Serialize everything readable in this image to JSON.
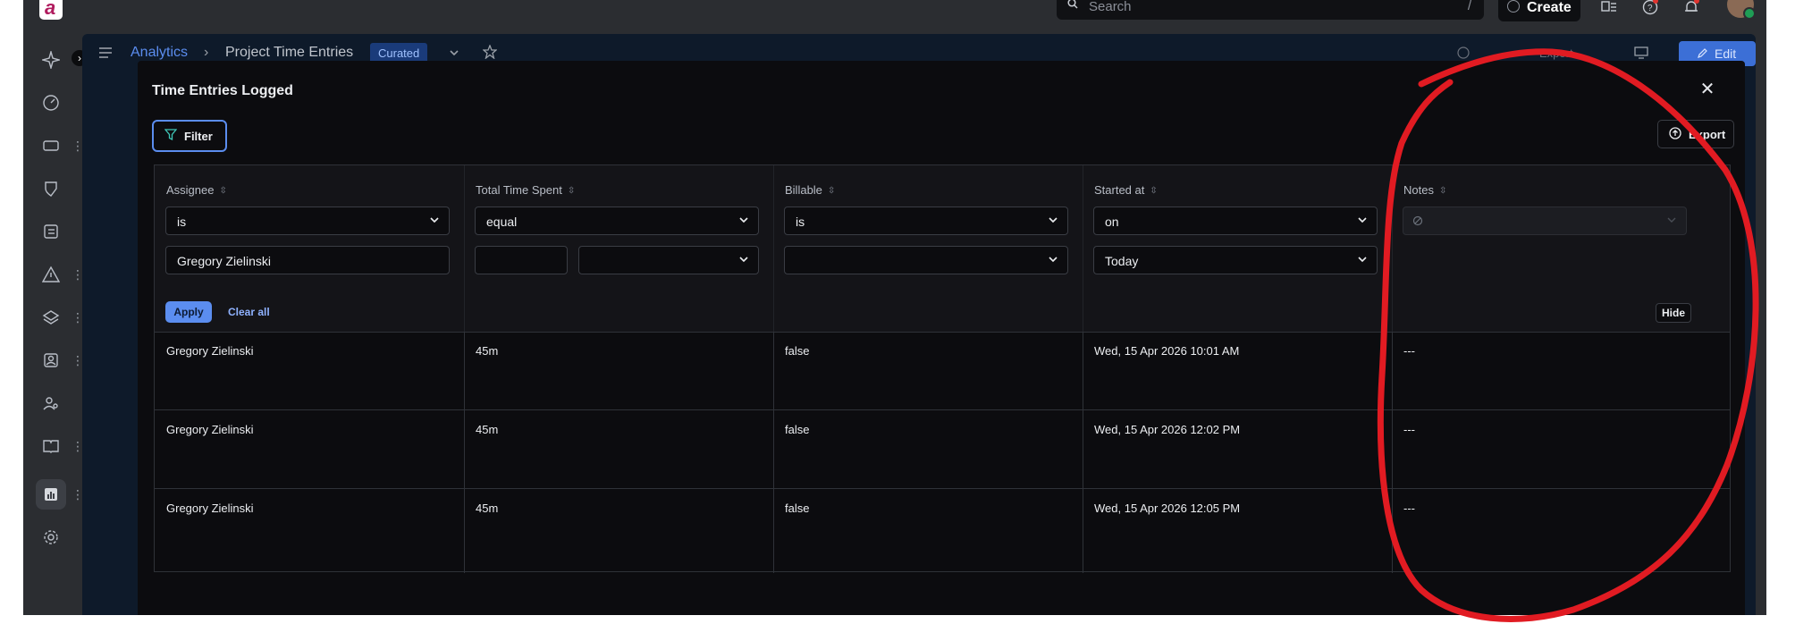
{
  "topbar": {
    "search_placeholder": "Search",
    "search_shortcut": "/",
    "create_label": "Create"
  },
  "rail": {
    "items": [
      "sparkle-icon",
      "gauge-icon",
      "ticket-icon",
      "shield-icon",
      "checklist-icon",
      "warning-icon",
      "layers-icon",
      "contact-icon",
      "people-icon",
      "book-icon",
      "report-icon",
      "settings-icon"
    ]
  },
  "page": {
    "breadcrumb_root": "Analytics",
    "breadcrumb_separator": "›",
    "breadcrumb_current": "Project Time Entries",
    "badge": "Curated",
    "export_label": "Export",
    "edit_label": "Edit"
  },
  "modal": {
    "title": "Time Entries Logged",
    "filter_label": "Filter",
    "export_label": "Export",
    "apply_label": "Apply",
    "clear_label": "Clear all",
    "hide_label": "Hide",
    "columns": [
      {
        "header": "Assignee",
        "operator": "is",
        "value": "Gregory Zielinski"
      },
      {
        "header": "Total Time Spent",
        "operator": "equal",
        "value": "",
        "unit": ""
      },
      {
        "header": "Billable",
        "operator": "is",
        "value": ""
      },
      {
        "header": "Started at",
        "operator": "on",
        "value": "Today"
      },
      {
        "header": "Notes",
        "operator": "",
        "value": ""
      }
    ],
    "rows": [
      [
        "Gregory Zielinski",
        "45m",
        "false",
        "Wed, 15 Apr 2026 10:01 AM",
        "---"
      ],
      [
        "Gregory Zielinski",
        "45m",
        "false",
        "Wed, 15 Apr 2026 12:02 PM",
        "---"
      ],
      [
        "Gregory Zielinski",
        "45m",
        "false",
        "Wed, 15 Apr 2026 12:05 PM",
        "---"
      ]
    ]
  },
  "colors": {
    "accent": "#5b8def",
    "annotation": "#e11b22",
    "modal_bg": "#0c0c0f"
  }
}
